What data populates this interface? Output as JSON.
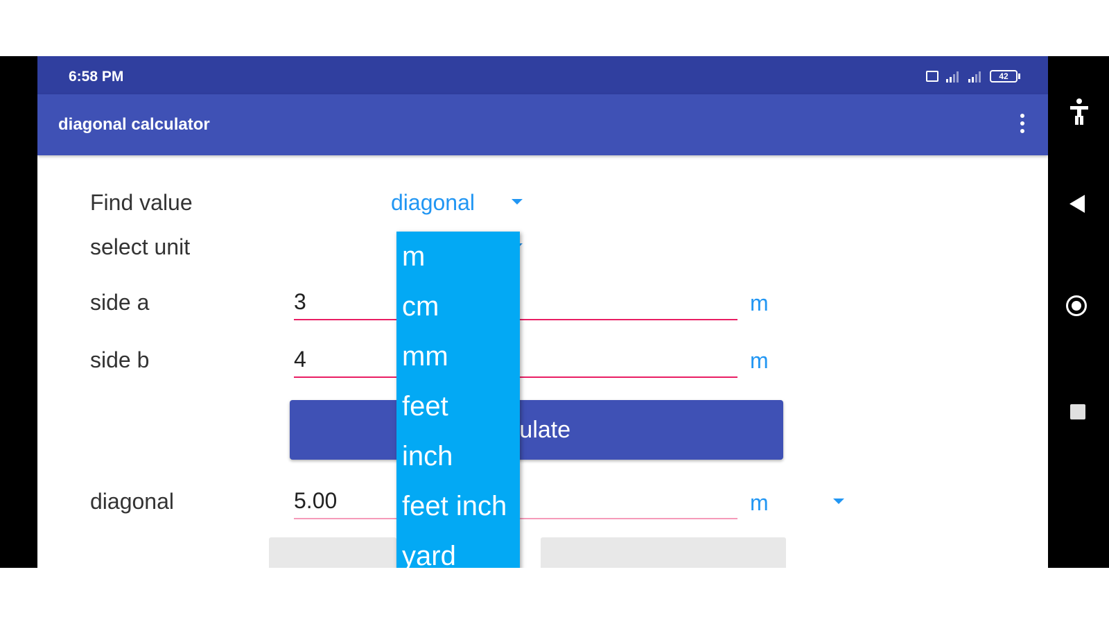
{
  "status_bar": {
    "time": "6:58 PM",
    "battery": "42"
  },
  "app_bar": {
    "title": "diagonal calculator"
  },
  "form": {
    "find_value_label": "Find value",
    "find_value_selected": "diagonal",
    "select_unit_label": "select unit",
    "side_a_label": "side a",
    "side_a_value": "3",
    "side_a_unit": "m",
    "side_b_label": "side b",
    "side_b_value": "4",
    "side_b_unit": "m",
    "calculate_label": "lculate",
    "result_label": "diagonal",
    "result_value": "5.00",
    "result_unit": "m"
  },
  "unit_dropdown": {
    "options": [
      "m",
      "cm",
      "mm",
      "feet",
      "inch",
      "feet inch",
      "yard"
    ]
  },
  "colors": {
    "status_bar": "#303f9f",
    "app_bar": "#3f51b5",
    "accent": "#2196f3",
    "dropdown": "#03a9f4",
    "underline": "#e91e63"
  }
}
